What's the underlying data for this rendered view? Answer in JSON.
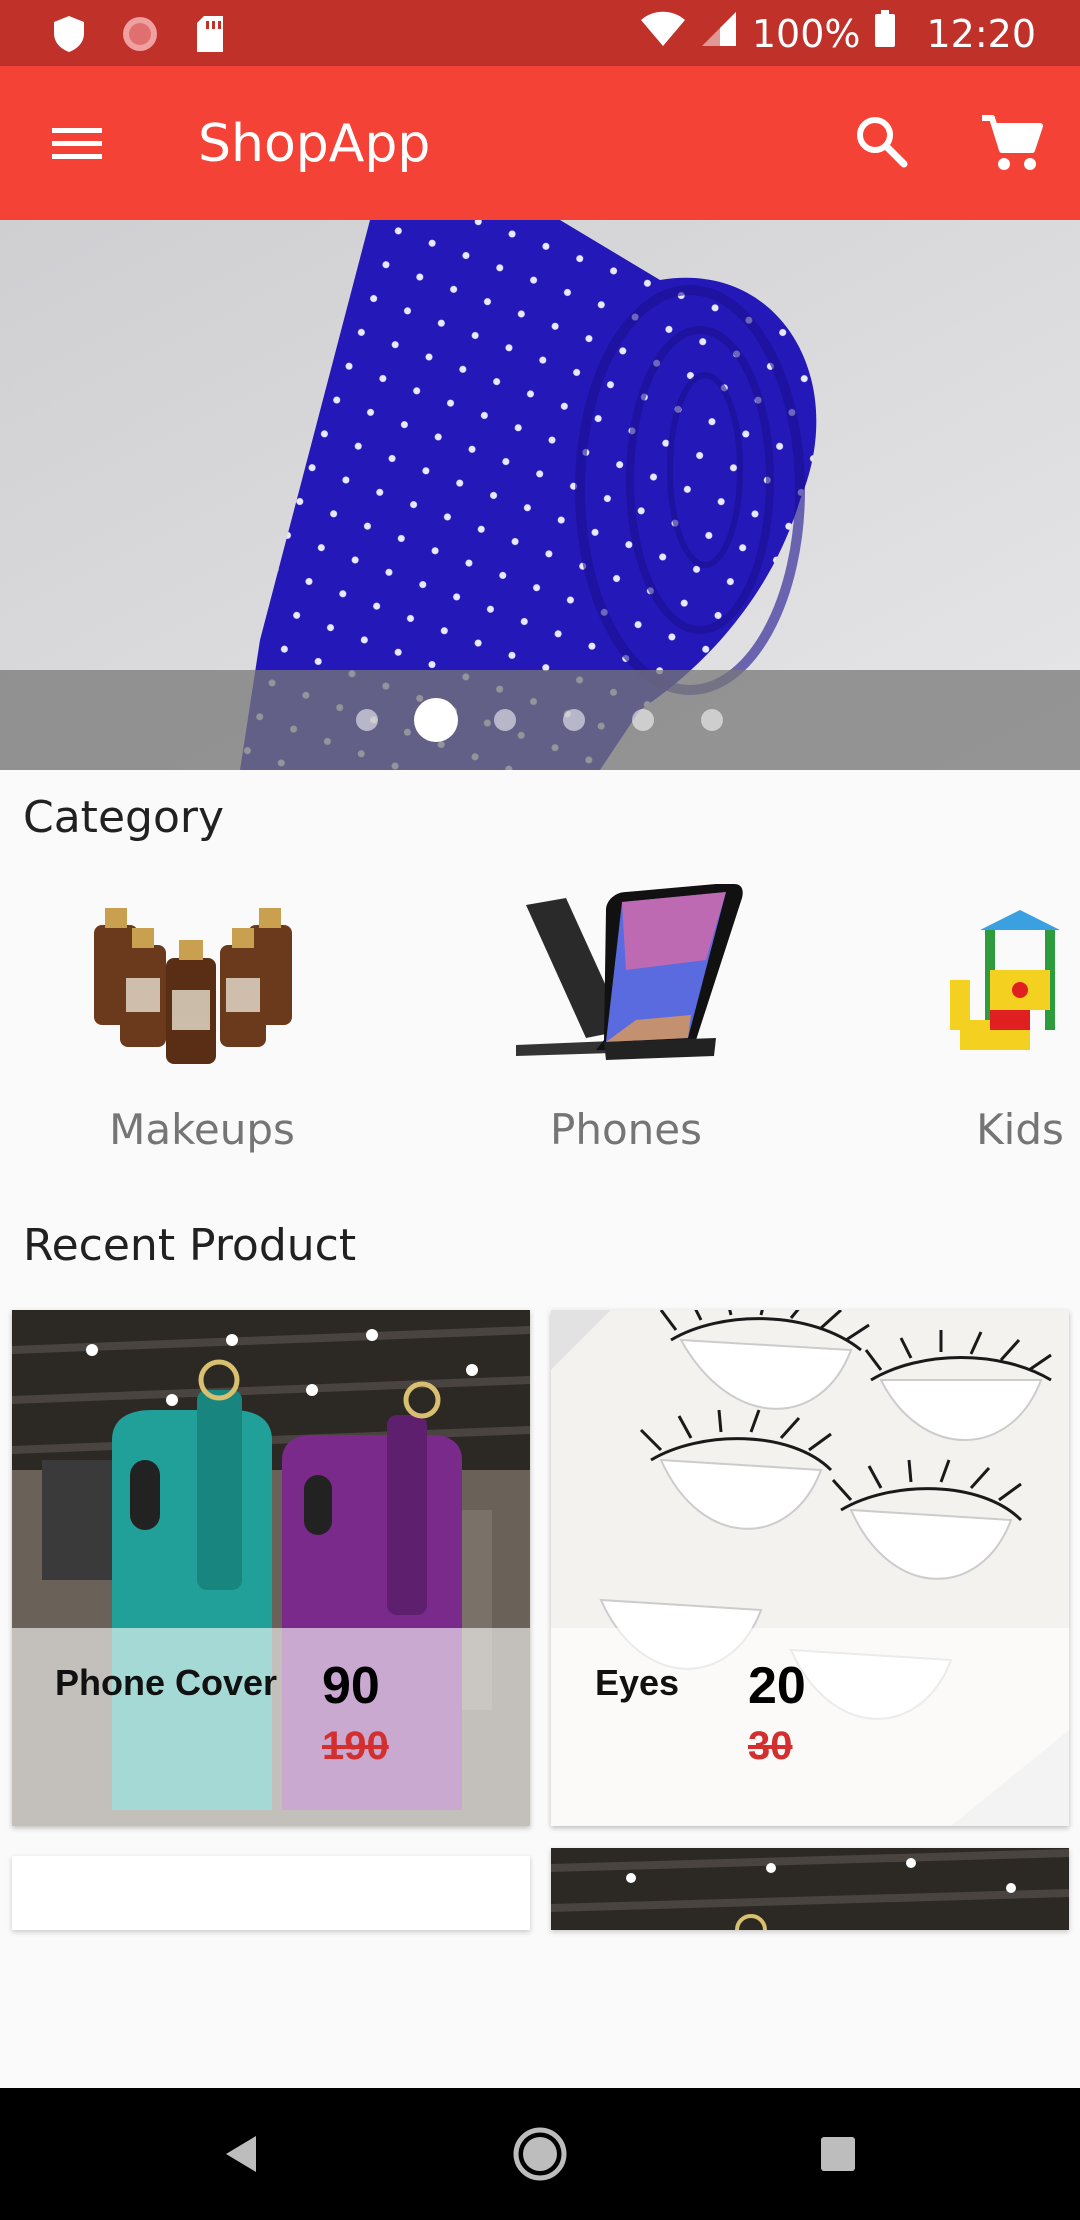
{
  "status_bar": {
    "battery": "100%",
    "time": "12:20",
    "icons": [
      "shield-icon",
      "record-icon",
      "sdcard-icon",
      "wifi-icon",
      "signal-icon",
      "battery-icon"
    ]
  },
  "app_bar": {
    "title": "ShopApp",
    "icons": [
      "menu-icon",
      "search-icon",
      "cart-icon"
    ],
    "color": "#f44336"
  },
  "carousel": {
    "slide_count": 6,
    "active_index": 1
  },
  "category": {
    "title": "Category",
    "items": [
      {
        "label": "Makeups"
      },
      {
        "label": "Phones"
      },
      {
        "label": "Kids"
      }
    ]
  },
  "recent": {
    "title": "Recent Product",
    "products": [
      {
        "name": "Phone Cover",
        "price": "90",
        "old_price": "190"
      },
      {
        "name": "Eyes",
        "price": "20",
        "old_price": "30"
      }
    ]
  },
  "colors": {
    "accent": "#f44336",
    "status_bar": "#c0312a",
    "old_price": "#d32f2f"
  }
}
